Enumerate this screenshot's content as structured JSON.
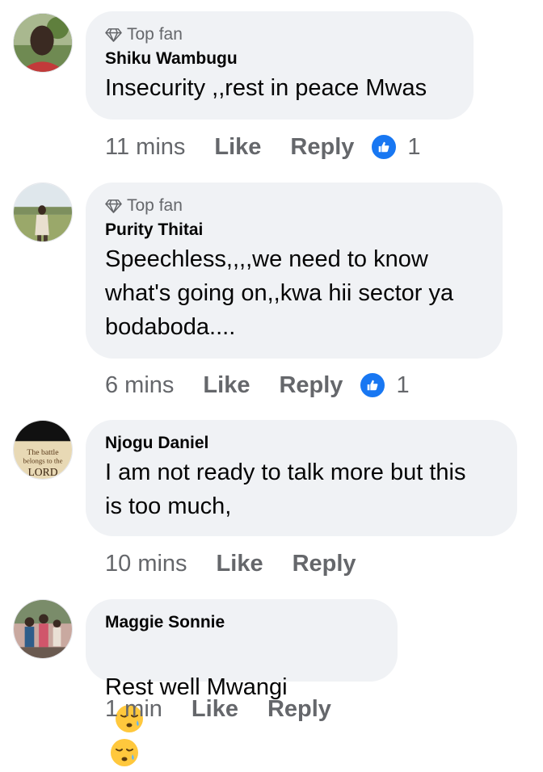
{
  "comments": [
    {
      "top_fan": "Top fan",
      "name": "Shiku Wambugu",
      "text": "Insecurity ,,rest in peace Mwas",
      "time": "11 mins",
      "like": "Like",
      "reply": "Reply",
      "reactions": "1"
    },
    {
      "top_fan": "Top fan",
      "name": "Purity Thitai",
      "text": "Speechless,,,,we need to know\nwhat's going on,,kwa hii sector ya\nbodaboda....",
      "time": "6 mins",
      "like": "Like",
      "reply": "Reply",
      "reactions": "1"
    },
    {
      "name": "Njogu Daniel",
      "text": "I am not ready to talk more but this\nis too much,",
      "time": "10 mins",
      "like": "Like",
      "reply": "Reply",
      "avatar_text": [
        "The battle",
        "belongs to the",
        "LORD"
      ]
    },
    {
      "name": "Maggie Sonnie",
      "text": "Rest well Mwangi",
      "emojis": [
        "sleepy-face-emoji",
        "sleepy-face-emoji"
      ],
      "time": "1 min",
      "like": "Like",
      "reply": "Reply"
    }
  ],
  "colors": {
    "bubble": "#f0f2f5",
    "meta_text": "#65676b",
    "like_blue": "#1877f2"
  }
}
